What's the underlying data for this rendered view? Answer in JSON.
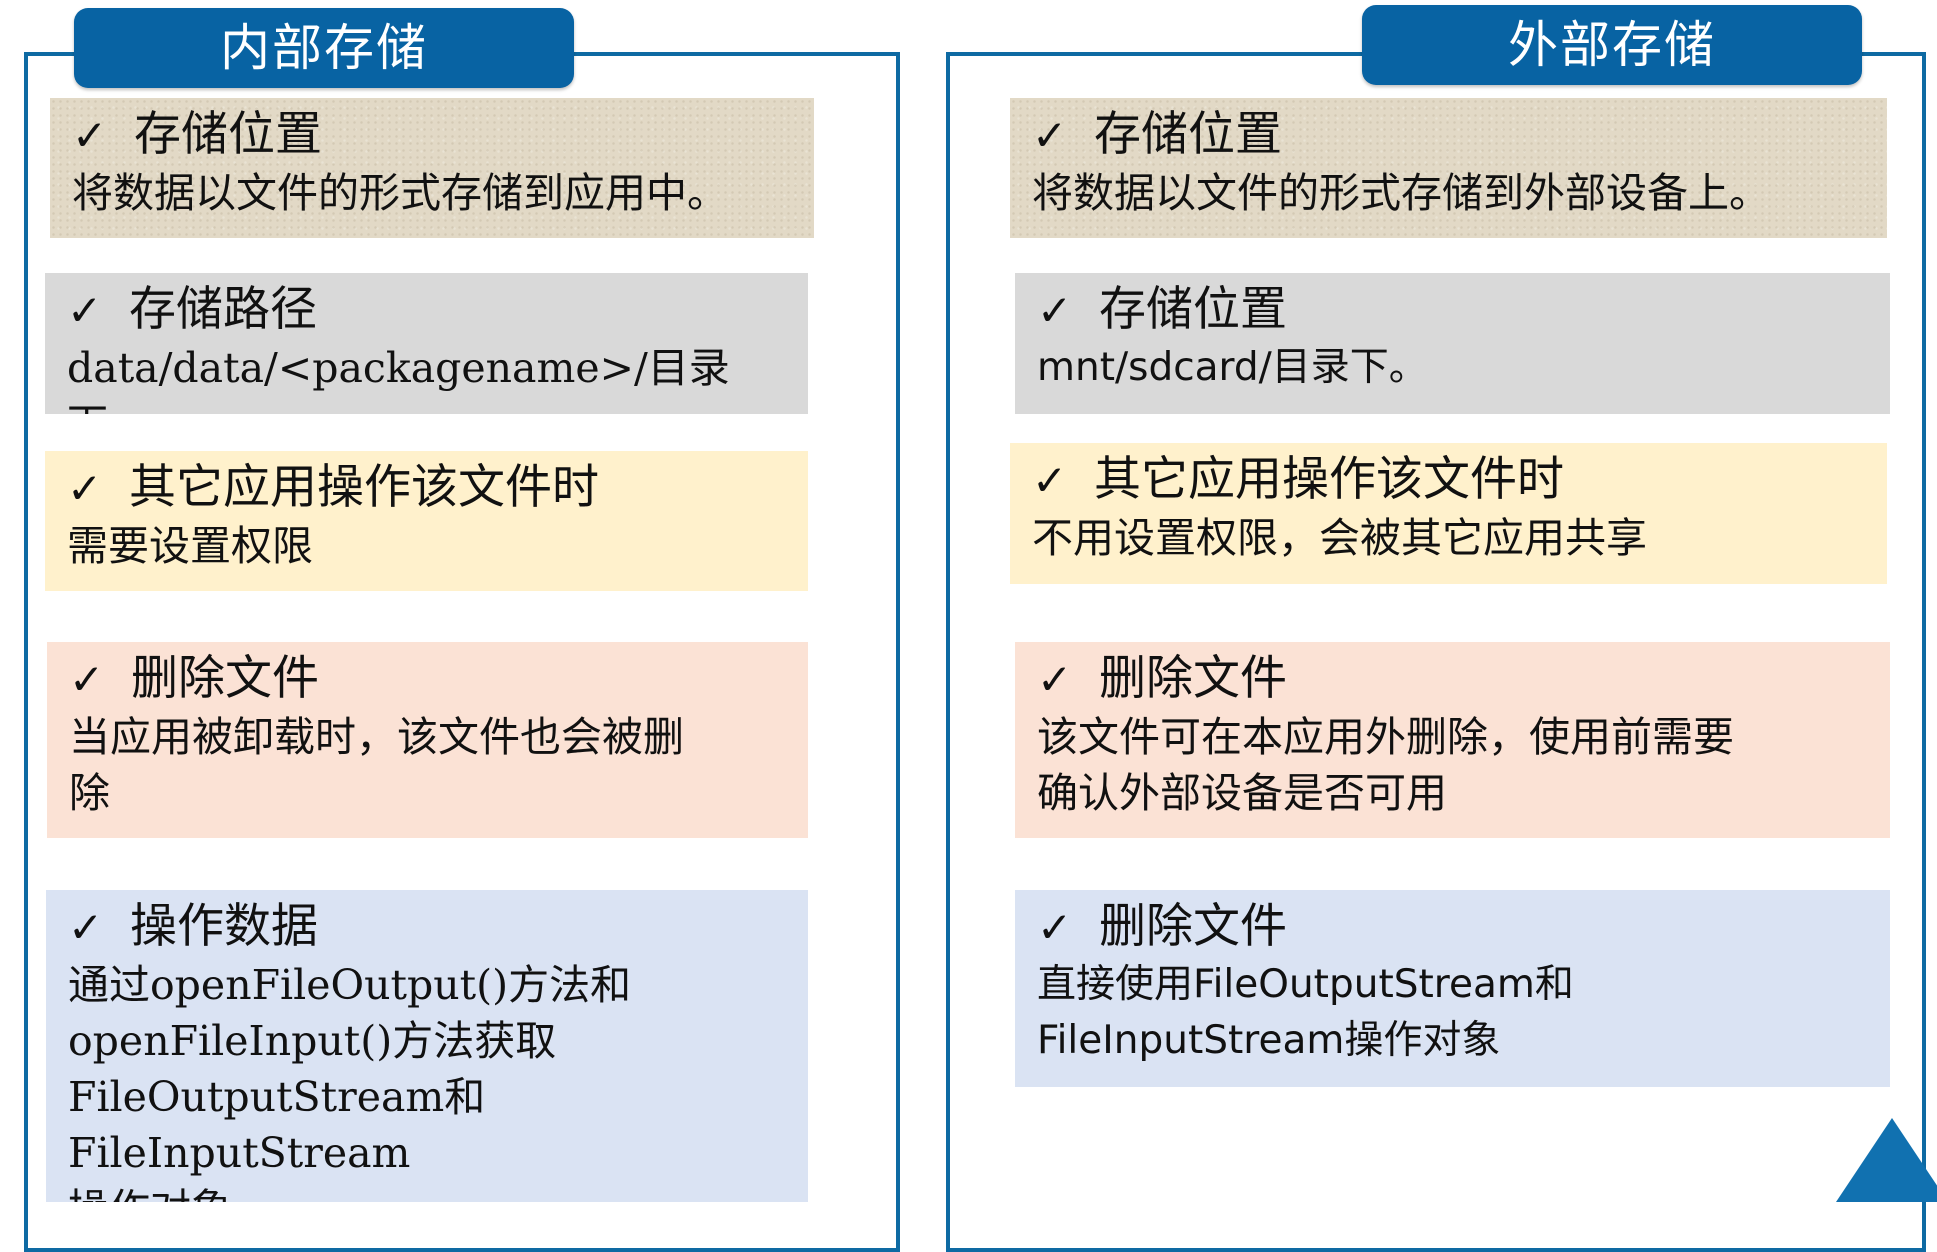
{
  "left": {
    "title": "内部存储",
    "cards": [
      {
        "check": "✓",
        "heading": "存储位置",
        "body": "将数据以文件的形式存储到应用中。"
      },
      {
        "check": "✓",
        "heading": "存储路径",
        "body": "data/data/<packagename>/目录下。"
      },
      {
        "check": "✓",
        "heading": "其它应用操作该文件时",
        "body": "需要设置权限"
      },
      {
        "check": "✓",
        "heading": "删除文件",
        "body": "当应用被卸载时，该文件也会被删\n除"
      },
      {
        "check": "✓",
        "heading": "操作数据",
        "body": "通过openFileOutput()方法和\nopenFileInput()方法获取\nFileOutputStream和FileInputStream\n操作对象"
      }
    ]
  },
  "right": {
    "title": "外部存储",
    "cards": [
      {
        "check": "✓",
        "heading": "存储位置",
        "body": "将数据以文件的形式存储到外部设备上。"
      },
      {
        "check": "✓",
        "heading": "存储位置",
        "body": "mnt/sdcard/目录下。"
      },
      {
        "check": "✓",
        "heading": "其它应用操作该文件时",
        "body": "不用设置权限，会被其它应用共享"
      },
      {
        "check": "✓",
        "heading": "删除文件",
        "body": "该文件可在本应用外删除，使用前需要\n确认外部设备是否可用"
      },
      {
        "check": "✓",
        "heading": "删除文件",
        "body": "直接使用FileOutputStream和\nFileInputStream操作对象"
      }
    ]
  },
  "colors": {
    "frame": "#0e6aa3",
    "title_bg": "#0863a3",
    "beige": "#e2d9c6",
    "grey": "#d9d9d9",
    "yellow": "#fff1cc",
    "salmon": "#fbe2d5",
    "blue": "#dae3f3"
  }
}
